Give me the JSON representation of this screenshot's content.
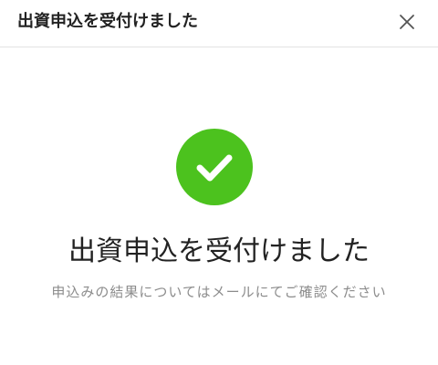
{
  "header": {
    "title": "出資申込を受付けました",
    "close_icon": "close-icon"
  },
  "main": {
    "status_icon": "checkmark-circle-icon",
    "status_color": "#4cc21e",
    "title": "出資申込を受付けました",
    "description": "申込みの結果についてはメールにてご確認ください"
  }
}
